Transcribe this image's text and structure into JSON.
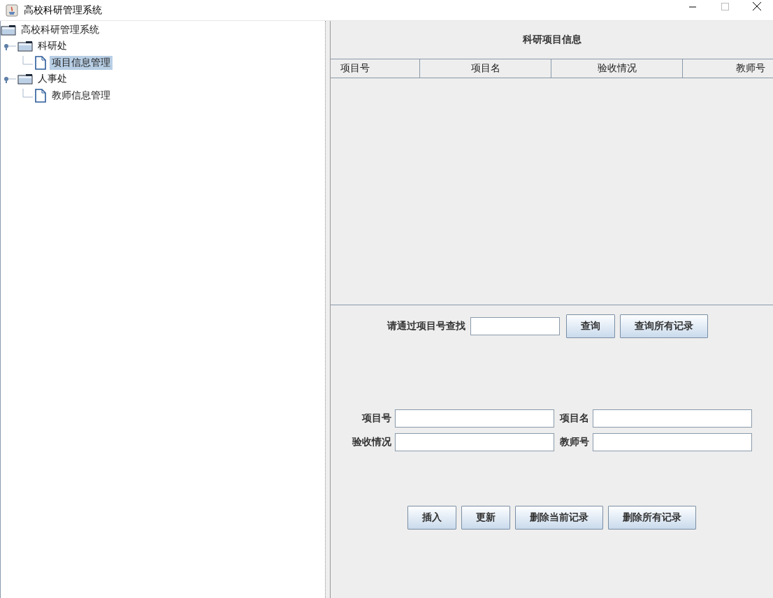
{
  "window": {
    "title": "高校科研管理系统"
  },
  "tree": [
    {
      "label": "高校科研管理系统",
      "kind": "folder",
      "selected": false,
      "children": [
        {
          "label": "科研处",
          "kind": "folder",
          "selected": false,
          "children": [
            {
              "label": "项目信息管理",
              "kind": "file",
              "selected": true
            }
          ]
        },
        {
          "label": "人事处",
          "kind": "folder",
          "selected": false,
          "children": [
            {
              "label": "教师信息管理",
              "kind": "file",
              "selected": false
            }
          ]
        }
      ]
    }
  ],
  "panel": {
    "title": "科研项目信息"
  },
  "table": {
    "columns": [
      "项目号",
      "项目名",
      "验收情况",
      "教师号"
    ]
  },
  "search": {
    "label": "请通过项目号查找",
    "buttons": [
      "查询",
      "查询所有记录"
    ]
  },
  "form": {
    "fields": [
      {
        "label": "项目号"
      },
      {
        "label": "项目名"
      },
      {
        "label": "验收情况"
      },
      {
        "label": "教师号"
      }
    ]
  },
  "actions": [
    "插入",
    "更新",
    "删除当前记录",
    "删除所有记录"
  ]
}
